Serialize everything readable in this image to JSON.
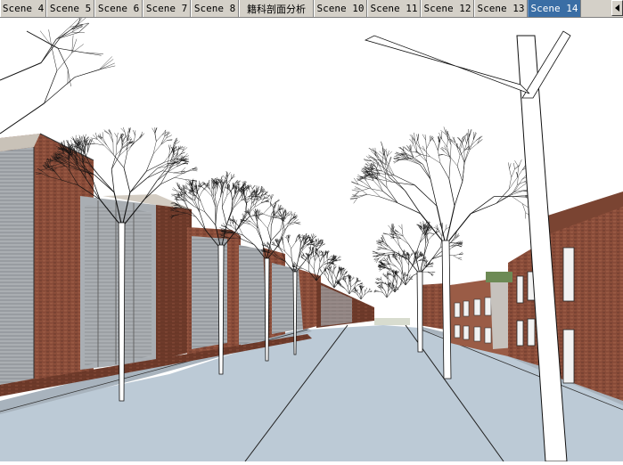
{
  "scene_tabs": [
    {
      "label": "Scene 4",
      "active": false
    },
    {
      "label": "Scene 5",
      "active": false
    },
    {
      "label": "Scene 6",
      "active": false
    },
    {
      "label": "Scene 7",
      "active": false
    },
    {
      "label": "Scene 8",
      "active": false
    },
    {
      "label": "籍科剖面分析",
      "active": false
    },
    {
      "label": "Scene 10",
      "active": false
    },
    {
      "label": "Scene 11",
      "active": false
    },
    {
      "label": "Scene 12",
      "active": false
    },
    {
      "label": "Scene 13",
      "active": false
    },
    {
      "label": "Scene 14",
      "active": true
    }
  ],
  "scroll_left_icon": "triangle-left-icon",
  "colors": {
    "tab_active": "#3a6ea5",
    "sky": "#ffffff",
    "ground": "#bccad6",
    "brick": "#8d4f3b",
    "brick_dark": "#6e3a2a",
    "glass": "#a9aeb3"
  }
}
